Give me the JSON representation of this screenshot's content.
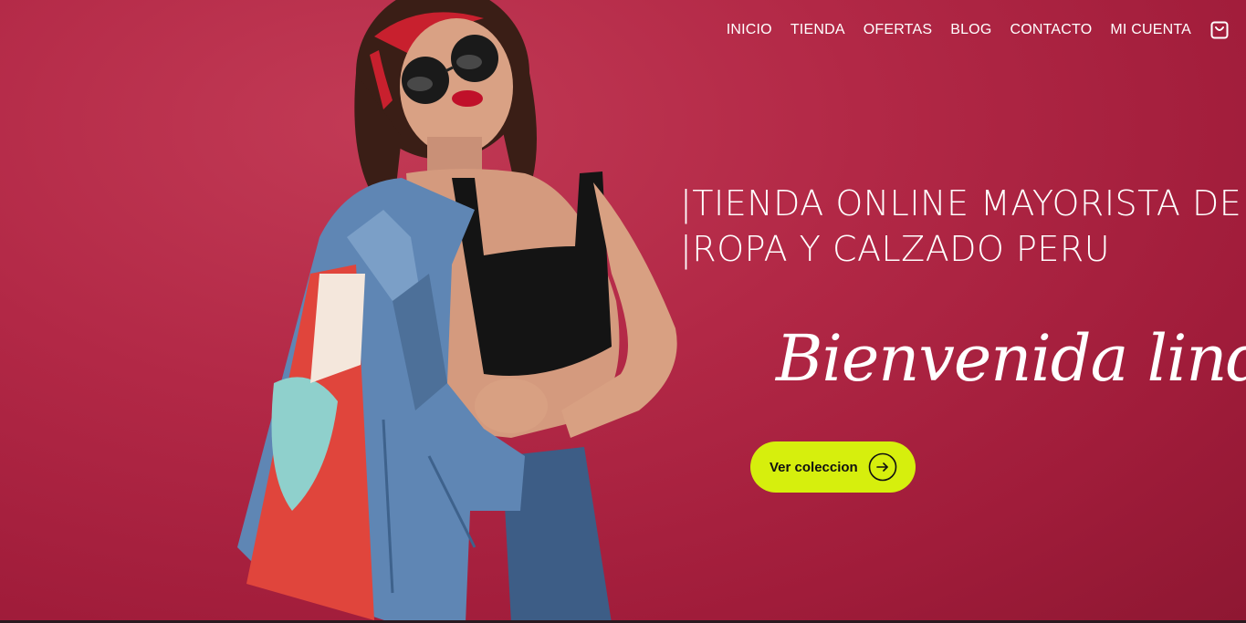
{
  "nav": {
    "items": [
      {
        "label": "INICIO"
      },
      {
        "label": "TIENDA"
      },
      {
        "label": "OFERTAS"
      },
      {
        "label": "BLOG"
      },
      {
        "label": "CONTACTO"
      },
      {
        "label": "MI CUENTA"
      }
    ],
    "cart_icon": "shopping-bag-icon"
  },
  "hero": {
    "headline_line1": "|TIENDA ONLINE MAYORISTA DE",
    "headline_line2": "|ROPA Y CALZADO PERU",
    "script_text": "Bienvenida linda",
    "cta_label": "Ver coleccion",
    "cta_icon": "arrow-right-circle-icon",
    "image_alt": "woman in denim jacket and sunglasses"
  },
  "colors": {
    "background": "#b22846",
    "cta": "#d6ef0d",
    "text": "#ffffff"
  }
}
